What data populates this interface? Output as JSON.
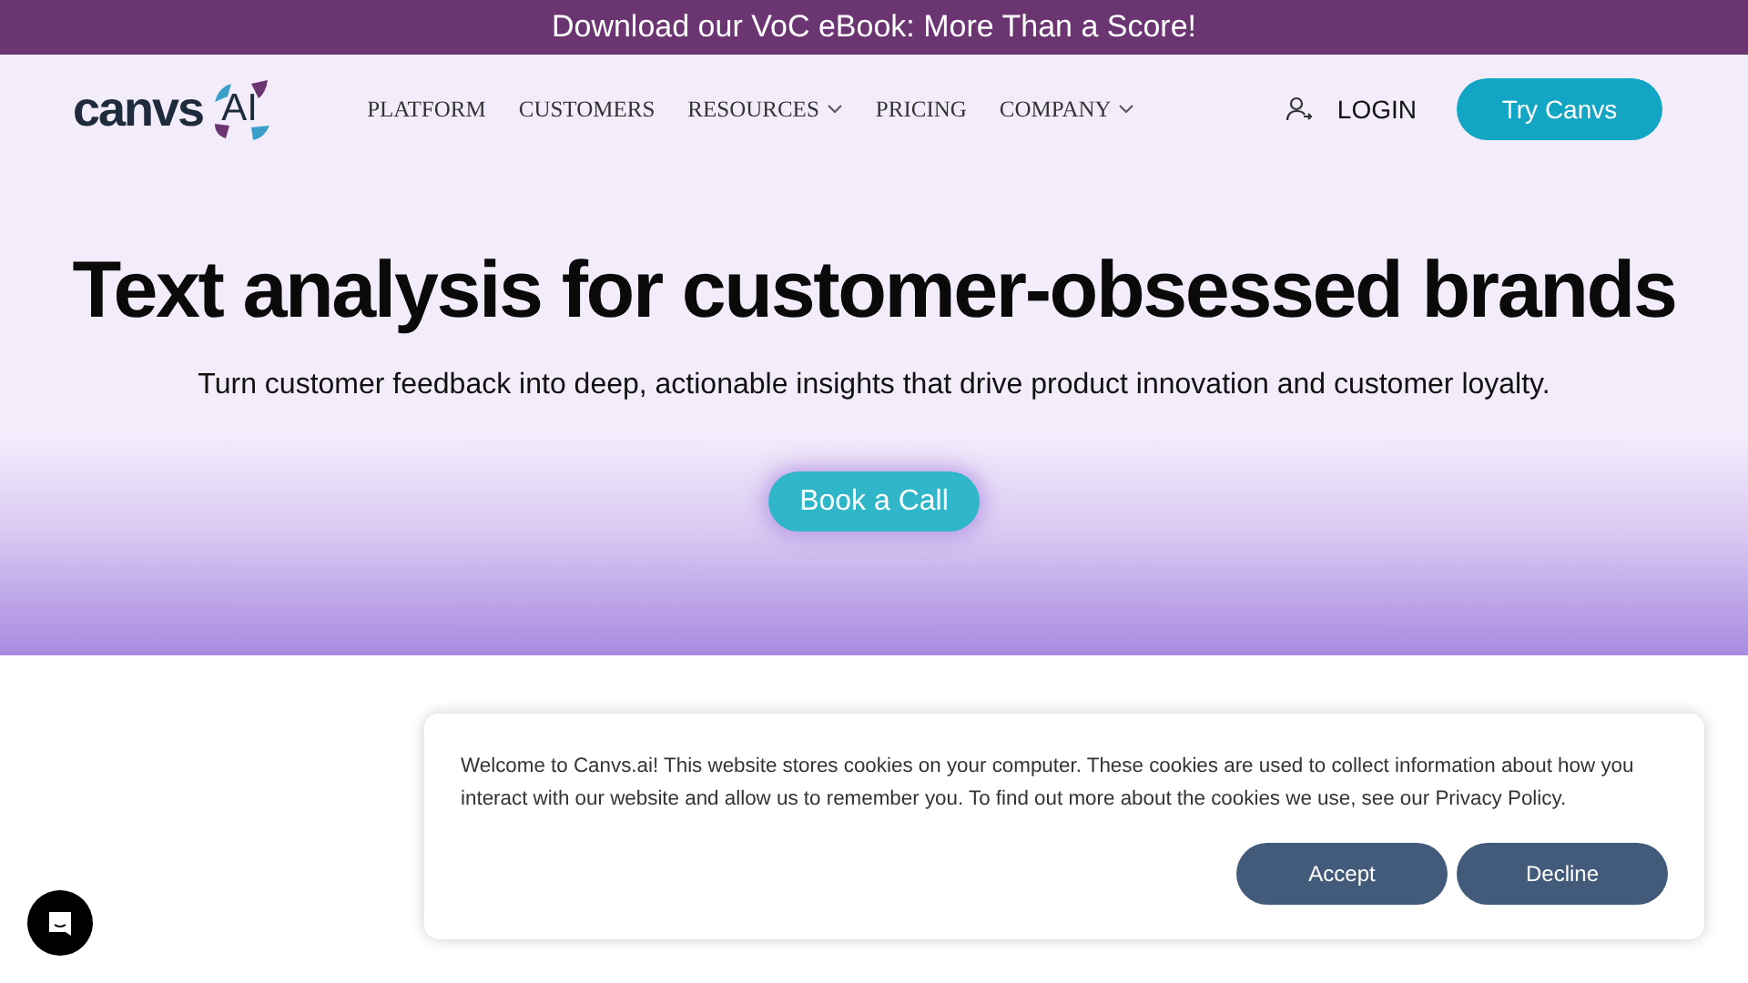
{
  "announcement": "Download our VoC eBook: More Than a Score!",
  "header": {
    "logo": {
      "wordmark": "canvs",
      "mark": "AI"
    },
    "nav": [
      {
        "label": "PLATFORM",
        "dropdown": false
      },
      {
        "label": "CUSTOMERS",
        "dropdown": false
      },
      {
        "label": "RESOURCES",
        "dropdown": true
      },
      {
        "label": "PRICING",
        "dropdown": false
      },
      {
        "label": "COMPANY",
        "dropdown": true
      }
    ],
    "login": "LOGIN",
    "cta": "Try Canvs"
  },
  "hero": {
    "title": "Text analysis for customer-obsessed brands",
    "subtitle": "Turn customer feedback into deep, actionable insights that drive product innovation and customer loyalty.",
    "button": "Book a Call"
  },
  "cookie_banner": {
    "text": "Welcome to Canvs.ai! This website stores cookies on your computer. These cookies are used to collect information about how you interact with our website and allow us to remember you. To find out more about the cookies we use, see our Privacy Policy.",
    "buttons": [
      "Accept",
      "Decline"
    ]
  }
}
